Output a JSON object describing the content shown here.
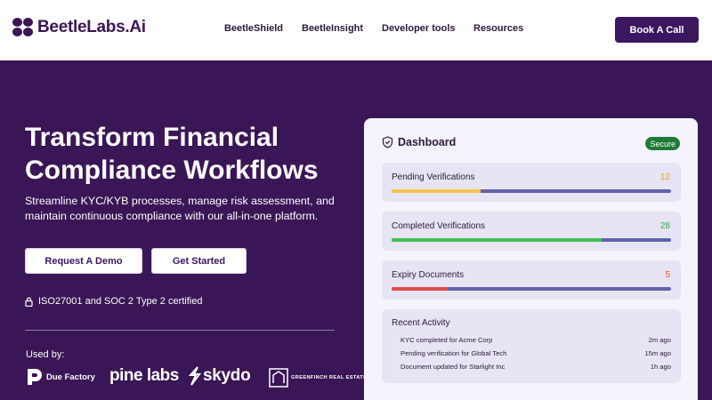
{
  "nav": {
    "logo_text": "BeetleLabs.Ai",
    "links": [
      "BeetleShield",
      "BeetleInsight",
      "Developer tools",
      "Resources"
    ],
    "cta_label": "Book A Call"
  },
  "hero": {
    "title": "Transform Financial Compliance Workflows",
    "subtitle": "Streamline KYC/KYB processes, manage risk assessment, and maintain continuous compliance with our all-in-one platform.",
    "demo_label": "Request A Demo",
    "start_label": "Get Started",
    "cert_text": "ISO27001 and SOC 2 Type 2 certified",
    "used_by_label": "Used by:",
    "partners": [
      "Due Factory",
      "pine labs",
      "skydo",
      "GREENFINCH REAL ESTATE"
    ]
  },
  "dashboard": {
    "title": "Dashboard",
    "badge": "Secure",
    "metrics": [
      {
        "label": "Pending Verifications",
        "value": "12",
        "fill_fraction": 0.32,
        "color": "#f5c451",
        "value_color": "#e0a020"
      },
      {
        "label": "Completed Verifications",
        "value": "28",
        "fill_fraction": 0.75,
        "color": "#3fbd57",
        "value_color": "#34a852"
      },
      {
        "label": "Expiry Documents",
        "value": "5",
        "fill_fraction": 0.2,
        "color": "#dd4b4b",
        "value_color": "#e0502e"
      }
    ],
    "activity_title": "Recent Activity",
    "activity": [
      {
        "text": "KYC completed for Acme Corp",
        "time": "2m ago"
      },
      {
        "text": "Pending verification for Global Tech",
        "time": "15m ago"
      },
      {
        "text": "Document updated for Starlight Inc",
        "time": "1h ago"
      }
    ]
  },
  "colors": {
    "brand": "#3a1656",
    "cta": "#3b1760",
    "track": "#6262a8",
    "secure": "#1f7a36"
  }
}
